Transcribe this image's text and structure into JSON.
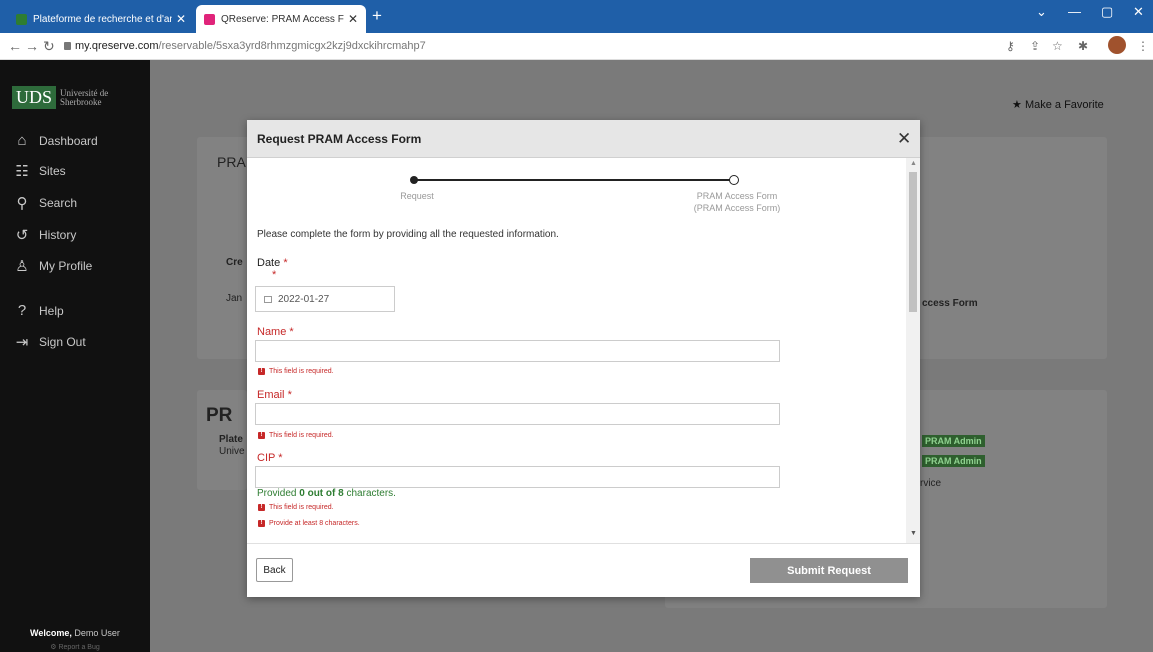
{
  "browser": {
    "tabs": [
      {
        "title": "Plateforme de recherche et d'ana",
        "active": false
      },
      {
        "title": "QReserve: PRAM Access Form at",
        "active": true
      }
    ],
    "new_tab": "+",
    "url_host": "my.qreserve.com",
    "url_path": "/reservable/5sxa3yrd8rhmzgmicgx2kzj9dxckihrcmahp7",
    "colors": {
      "tabbar": "#1f5fa8",
      "brand_green": "#2e6b3b"
    }
  },
  "sidebar": {
    "logo_abbr": "UDS",
    "logo_line1": "Université de",
    "logo_line2": "Sherbrooke",
    "items": [
      {
        "label": "Dashboard",
        "icon": "home-icon"
      },
      {
        "label": "Sites",
        "icon": "sites-icon"
      },
      {
        "label": "Search",
        "icon": "search-icon"
      },
      {
        "label": "History",
        "icon": "history-icon"
      },
      {
        "label": "My Profile",
        "icon": "user-icon"
      },
      {
        "label": "Help",
        "icon": "help-icon"
      },
      {
        "label": "Sign Out",
        "icon": "sign-out-icon"
      }
    ],
    "welcome_prefix": "Welcome,",
    "welcome_user": "Demo User",
    "report_bug": "Report a Bug"
  },
  "background": {
    "favorite": "Make a Favorite",
    "card1_title": "PRA",
    "col_cre": "Cre",
    "row_jan": "Jan",
    "access_form": "ccess Form",
    "card2_title": "PR",
    "plate": "Plate",
    "unive": "Unive",
    "pram_admin": "PRAM Admin",
    "service": "rvice"
  },
  "modal": {
    "title": "Request PRAM Access Form",
    "steps": [
      {
        "label": "Request",
        "done": true
      },
      {
        "label": "PRAM Access Form",
        "sub": "(PRAM Access Form)",
        "done": false
      }
    ],
    "instructions": "Please complete the form by providing all the requested information.",
    "fields": {
      "date": {
        "label": "Date",
        "value": "2022-01-27"
      },
      "name": {
        "label": "Name",
        "value": "",
        "error": "This field is required."
      },
      "email": {
        "label": "Email",
        "value": "",
        "error": "This field is required."
      },
      "cip": {
        "label": "CIP",
        "value": "",
        "provided_prefix": "Provided",
        "provided_count": "0 out of 8",
        "provided_suffix": "characters.",
        "errors": [
          "This field is required.",
          "Provide at least 8 characters."
        ]
      }
    },
    "required_mark": "*",
    "back_label": "Back",
    "submit_label": "Submit Request"
  }
}
